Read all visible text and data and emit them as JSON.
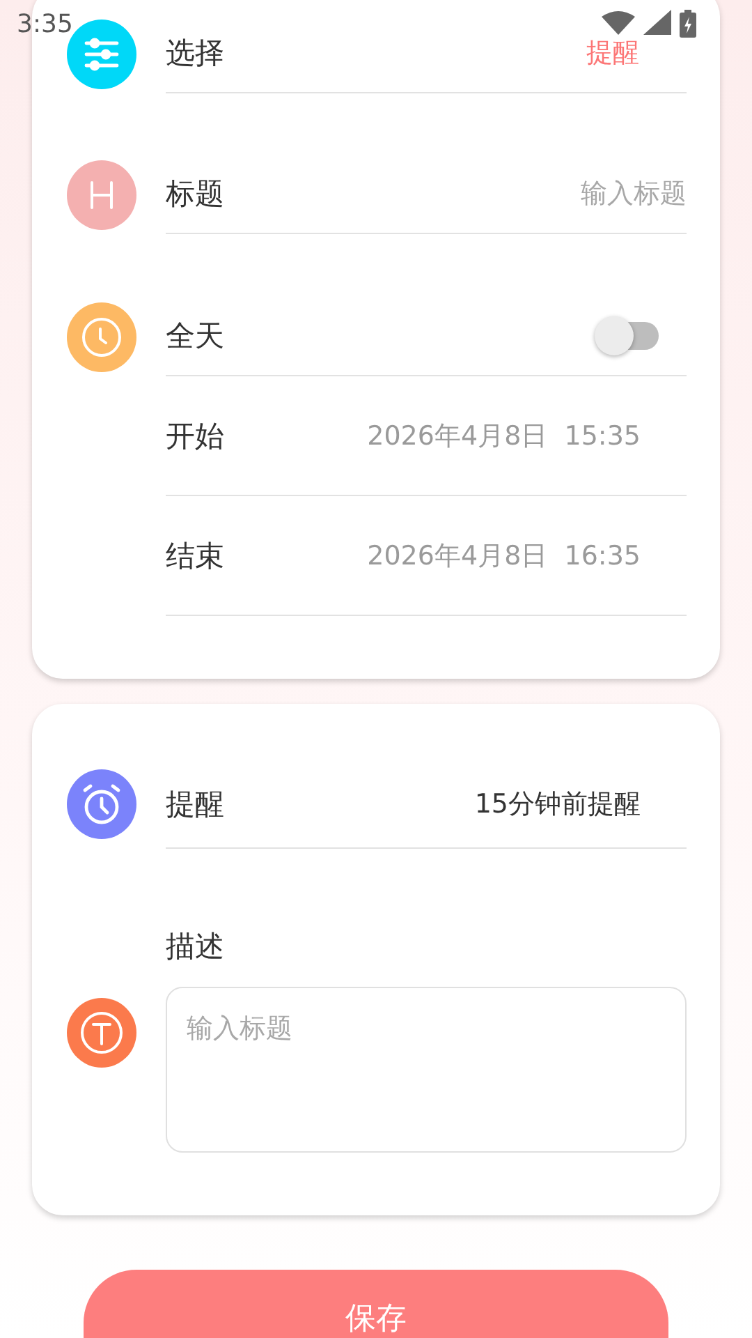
{
  "status_bar": {
    "time": "3:35"
  },
  "event_card": {
    "rows": [
      {
        "kind": "picker",
        "label": "选择",
        "value": "提醒",
        "color": "#00d8f8"
      },
      {
        "kind": "input",
        "label": "标题",
        "placeholder": "输入标题",
        "color": "#f4b0b0"
      },
      {
        "kind": "toggle",
        "label": "全天",
        "on": false,
        "color": "#fdb964"
      },
      {
        "kind": "datetime",
        "label": "开始",
        "value": "2026年4月8日  15:35"
      },
      {
        "kind": "datetime",
        "label": "结束",
        "value": "2026年4月8日  16:35"
      }
    ]
  },
  "reminder_card": {
    "rows": [
      {
        "kind": "option",
        "label": "提醒",
        "value": "15分钟前提醒",
        "color": "#7b83fb"
      },
      {
        "kind": "textarea",
        "label": "描述",
        "placeholder": "输入标题",
        "color": "#fb7a4c"
      }
    ]
  },
  "save_button": {
    "label": "保存"
  }
}
